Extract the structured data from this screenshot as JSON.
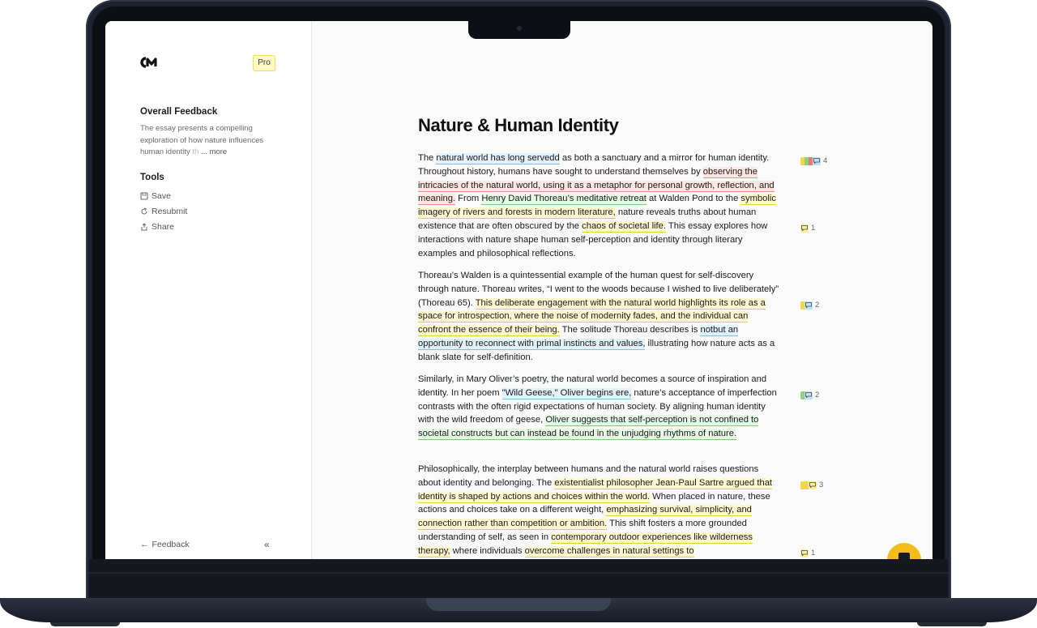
{
  "sidebar": {
    "pro_label": "Pro",
    "overall_feedback_heading": "Overall Feedback",
    "feedback_snippet": "The essay presents a compelling exploration of how nature influences human identity",
    "feedback_fade": "th",
    "more_label": "... more",
    "tools_heading": "Tools",
    "tools": [
      {
        "label": "Save",
        "icon": "save-icon"
      },
      {
        "label": "Resubmit",
        "icon": "redo-icon"
      },
      {
        "label": "Share",
        "icon": "share-icon"
      }
    ],
    "bottom_feedback_label": "Feedback",
    "collapse_label": "«"
  },
  "document": {
    "title": "Nature & Human Identity",
    "paragraphs": [
      [
        {
          "t": "The "
        },
        {
          "t": "natural world has long servedd",
          "c": "blue"
        },
        {
          "t": " as both a sanctuary and a mirror for human identity. Throughout history, humans have sought to understand themselves by "
        },
        {
          "t": "observing the intricacies of the natural world, using it as a metaphor for personal growth, reflection, and meaning.",
          "c": "red"
        },
        {
          "t": " From "
        },
        {
          "t": "Henry David Thoreau’s meditative retreat",
          "c": "green"
        },
        {
          "t": " at Walden Pond to the "
        },
        {
          "t": "symbolic imagery of rivers and forests in modern literature,",
          "c": "yellow"
        },
        {
          "t": " nature reveals truths about human existence that are often obscured by the "
        },
        {
          "t": "chaos of societal life.",
          "c": "yellow"
        },
        {
          "t": " This essay explores how interactions with nature shape human self-perception and identity through literary examples and philosophical reflections."
        }
      ],
      [
        {
          "t": "Thoreau’s Walden is a quintessential example of the human quest for self-discovery through nature. Thoreau writes, “I went to the woods because I wished to live deliberately” (Thoreau 65). "
        },
        {
          "t": "This deliberate engagement with the natural world highlights its role as a space for introspection, where the noise of modernity fades, and the individual can confront the essence of their being.",
          "c": "yellow"
        },
        {
          "t": " The solitude Thoreau describes is "
        },
        {
          "t": "notbut an opportunity to reconnect with primal instincts and values,",
          "c": "blue"
        },
        {
          "t": " illustrating how nature acts as a blank slate for self-definition."
        }
      ],
      [
        {
          "t": "Similarly, in Mary Oliver’s poetry, the natural world becomes a source of inspiration and identity. In her poem "
        },
        {
          "t": "\"Wild Geese,\" Oliver begins ere,",
          "c": "blue"
        },
        {
          "t": " nature’s acceptance of imperfection contrasts with the often rigid expectations of human society. By aligning human identity with the wild freedom of geese, "
        },
        {
          "t": "Oliver suggests that self-perception is not confined to societal constructs but can instead be found in the unjudging rhythms of nature.",
          "c": "green"
        }
      ],
      [
        {
          "t": "Philosophically, the interplay between humans and the natural world raises questions about identity and belonging. The "
        },
        {
          "t": "existentialist philosopher Jean-Paul Sartre argued that identity is shaped by actions and choices within the world.",
          "c": "yellow"
        },
        {
          "t": " When placed in nature, these actions and choices take on a different weight, "
        },
        {
          "t": "emphasizing survival, simplicity, and connection rather than competition or ambition.",
          "c": "yellow"
        },
        {
          "t": " This shift fosters a more grounded understanding of self, as seen in "
        },
        {
          "t": "contemporary outdoor experiences like wilderness therapy,",
          "c": "yellow"
        },
        {
          "t": " where individuals "
        },
        {
          "t": "overcome challenges in natural settings to",
          "c": "yellow"
        }
      ]
    ]
  },
  "markers": [
    {
      "count": "4",
      "segments": [
        "#f2d64b",
        "#8fd17f",
        "#e87b6f"
      ],
      "icon_color": "blue"
    },
    {
      "count": "1",
      "segments": [],
      "icon_color": "yellow"
    },
    {
      "count": "2",
      "segments": [
        "#f2d64b"
      ],
      "icon_color": "blue"
    },
    {
      "count": "2",
      "segments": [
        "#8fd17f"
      ],
      "icon_color": "blue"
    },
    {
      "count": "3",
      "segments": [
        "#f2d64b",
        "#f2d64b"
      ],
      "icon_color": "yellow"
    },
    {
      "count": "1",
      "segments": [],
      "icon_color": "yellow"
    }
  ],
  "colors": {
    "accent": "#f2bd1b",
    "pro_badge": "#fff9c8"
  }
}
